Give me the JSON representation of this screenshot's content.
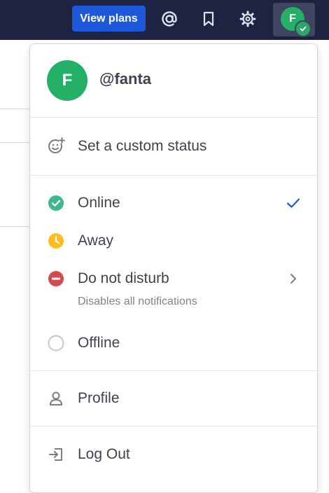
{
  "topbar": {
    "view_plans_label": "View plans",
    "icons": [
      "at-mention-icon",
      "bookmark-icon",
      "gear-icon"
    ],
    "avatar_initial": "F"
  },
  "menu": {
    "user": {
      "initial": "F",
      "username": "@fanta"
    },
    "custom_status_label": "Set a custom status",
    "statuses": [
      {
        "label": "Online",
        "color": "#3db887",
        "selected": true
      },
      {
        "label": "Away",
        "color": "#ffbc1f"
      },
      {
        "label": "Do not disturb",
        "color": "#d24b4e",
        "sublabel": "Disables all notifications",
        "has_submenu": true
      },
      {
        "label": "Offline",
        "color": "#c4c6cb"
      }
    ],
    "profile_label": "Profile",
    "logout_label": "Log Out"
  },
  "colors": {
    "topbar_bg": "#1e2341",
    "button_blue": "#1c58d9",
    "avatar_green": "#25b067",
    "check_blue": "#1c58d9"
  }
}
